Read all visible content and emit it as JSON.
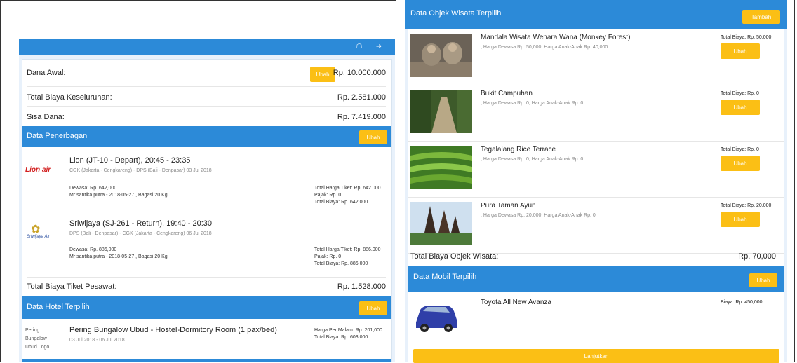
{
  "topbar": {
    "home_icon": "home-icon",
    "logout_icon": "logout-icon"
  },
  "summary": {
    "dana_awal_label": "Dana Awal:",
    "ubah_label": "Ubah",
    "dana_awal_value": "Rp. 10.000.000",
    "total_label": "Total Biaya Keseluruhan:",
    "total_value": "Rp. 2.581.000",
    "sisa_label": "Sisa Dana:",
    "sisa_value": "Rp. 7.419.000"
  },
  "flights_section": {
    "title": "Data Penerbagan",
    "ubah_label": "Ubah",
    "items": [
      {
        "logo_text": "Lion air",
        "name": "Lion (JT-10 - Depart), 20:45 - 23:35",
        "route": "CGK (Jakarta - Cengkareng) - DPS (Bali - Denpasar) 03 Jul 2018",
        "pax1": "Dewasa: Rp. 642,000",
        "pax2": "Mr santika putra - 2018-05-27 , Bagasi 20 Kg",
        "r1": "Total Harga Tiket: Rp. 642.000",
        "r2": "Pajak: Rp. 0",
        "r3": "Total Biaya: Rp. 642.000"
      },
      {
        "logo_text": "Sriwijaya Air",
        "name": "Sriwijaya (SJ-261 - Return), 19:40 - 20:30",
        "route": "DPS (Bali - Denpasar) - CGK (Jakarta - Cengkareng) 06 Jul 2018",
        "pax1": "Dewasa: Rp. 886,000",
        "pax2": "Mr santika putra - 2018-05-27 , Bagasi 20 Kg",
        "r1": "Total Harga Tiket: Rp. 886.000",
        "r2": "Pajak: Rp. 0",
        "r3": "Total Biaya: Rp. 886.000"
      }
    ],
    "total_label": "Total Biaya Tiket Pesawat:",
    "total_value": "Rp. 1.528.000"
  },
  "hotel_section": {
    "title": "Data Hotel Terpilih",
    "ubah_label": "Ubah",
    "logo_alt_1": "Pering",
    "logo_alt_2": "Bungalow",
    "logo_alt_3": "Ubud Logo",
    "name": "Pering Bungalow Ubud - Hostel-Dormitory Room (1 pax/bed)",
    "dates": "03 Jul 2018 - 06 Jul 2018",
    "price": "Harga Per Malam: Rp. 201,000",
    "total": "Total Biaya: Rp. 603,000"
  },
  "objek_section": {
    "title": "Data Objek Wisata Terpilih",
    "tambah_label": "Tambah",
    "items": [
      {
        "name": "Mandala Wisata Wenara Wana (Monkey Forest)",
        "desc": ", Harga Dewasa Rp. 50,000, Harga Anak-Anak Rp. 40,000",
        "total": "Total Biaya: Rp. 50,000",
        "ubah": "Ubah"
      },
      {
        "name": "Bukit Campuhan",
        "desc": ", Harga Dewasa Rp. 0, Harga Anak-Anak Rp. 0",
        "total": "Total Biaya: Rp. 0",
        "ubah": "Ubah"
      },
      {
        "name": "Tegalalang Rice Terrace",
        "desc": ", Harga Dewasa Rp. 0, Harga Anak-Anak Rp. 0",
        "total": "Total Biaya: Rp. 0",
        "ubah": "Ubah"
      },
      {
        "name": "Pura Taman Ayun",
        "desc": ", Harga Dewasa Rp. 20,000, Harga Anak-Anak Rp. 0",
        "total": "Total Biaya: Rp. 20,000",
        "ubah": "Ubah"
      }
    ],
    "total_label": "Total Biaya Objek Wisata:",
    "total_value": "Rp. 70,000"
  },
  "mobil_section": {
    "title": "Data Mobil Terpilih",
    "ubah_label": "Ubah",
    "name": "Toyota All New Avanza",
    "price": "Biaya: Rp. 450,000"
  },
  "lanjutkan_label": "Lanjutkan",
  "colors": {
    "primary": "#2c8ad8",
    "accent": "#fbbf15",
    "panel_bg": "#e8f1fb"
  }
}
